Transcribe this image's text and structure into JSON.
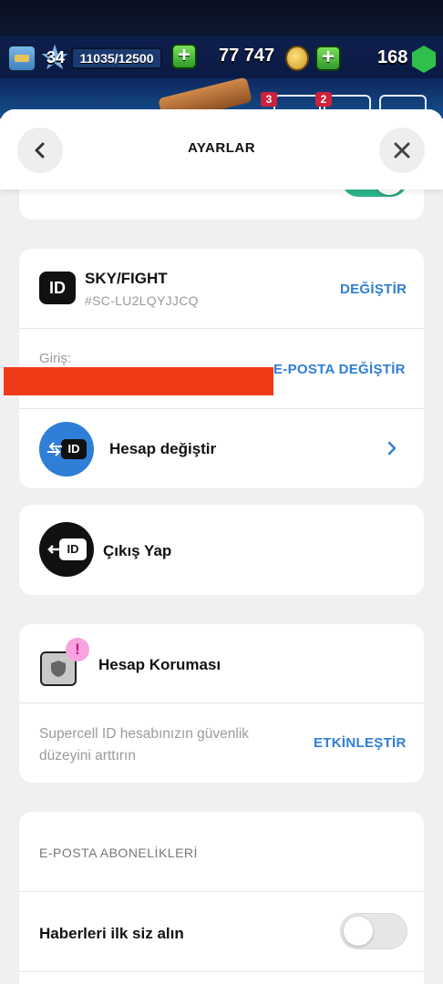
{
  "game_bar": {
    "level": "34",
    "xp": "11035/12500",
    "gold": "77 747",
    "gems": "168",
    "badge_left": "3",
    "badge_right": "2"
  },
  "header": {
    "title": "AYARLAR"
  },
  "account": {
    "name": "SKY/FIGHT",
    "id_tag": "#SC-LU2LQYJJCQ",
    "change_label": "DEĞİŞTİR",
    "login_label": "Giriş:",
    "change_email_label": "E-POSTA DEĞİŞTİR",
    "switch_account_label": "Hesap değiştir"
  },
  "logout": {
    "label": "Çıkış Yap"
  },
  "protection": {
    "title": "Hesap Koruması",
    "description": "Supercell ID hesabınızın güvenlik düzeyini arttırın",
    "enable_label": "ETKİNLEŞTİR"
  },
  "email_subscriptions": {
    "heading": "E-POSTA ABONELİKLERİ",
    "news_label": "Haberleri ilk siz alın",
    "news_enabled": false
  },
  "top_toggle_enabled": true,
  "colors": {
    "accent": "#2f7ed8",
    "toggle_on": "#2bb58a",
    "redaction": "#f03a17",
    "alert_badge": "#f7a3e0"
  }
}
